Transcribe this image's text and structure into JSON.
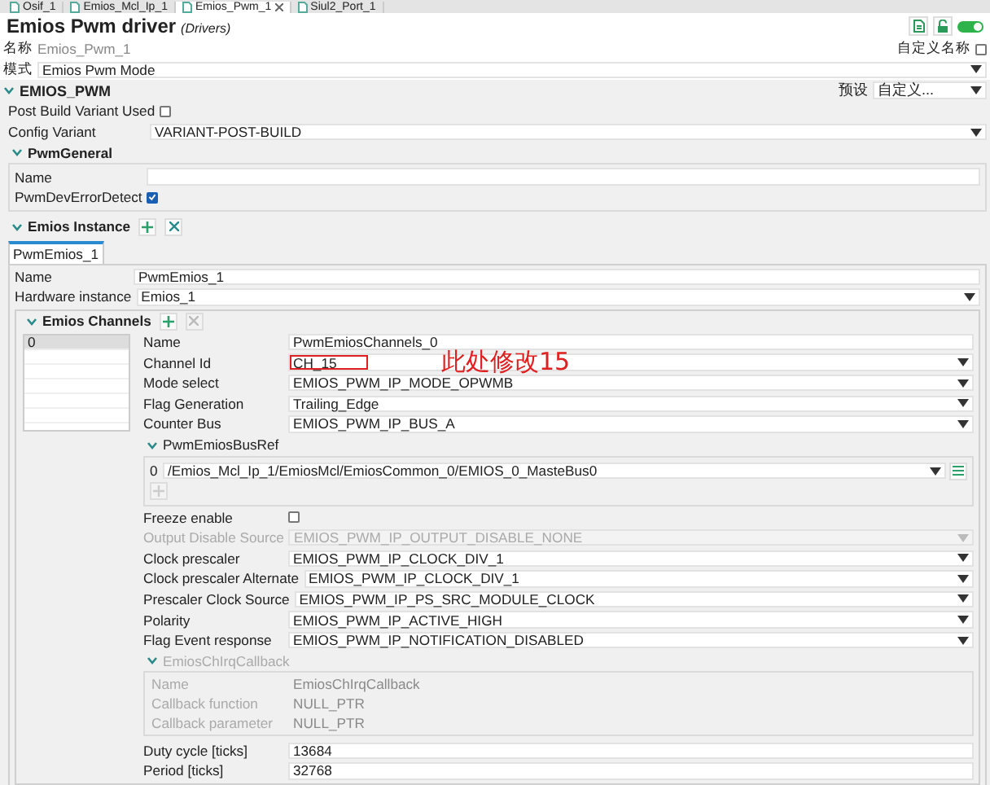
{
  "editor_tabs": [
    {
      "label": "Osif_1",
      "selected": false,
      "closable": false
    },
    {
      "label": "Emios_Mcl_Ip_1",
      "selected": false,
      "closable": false
    },
    {
      "label": "Emios_Pwm_1",
      "selected": true,
      "closable": true
    },
    {
      "label": "Siul2_Port_1",
      "selected": false,
      "closable": false
    }
  ],
  "header": {
    "title": "Emios Pwm driver",
    "subtitle": "(Drivers)",
    "toggle_on": true,
    "name_label": "名称",
    "name_value": "Emios_Pwm_1",
    "custom_name_label": "自定义名称",
    "custom_name_checked": false,
    "mode_label": "模式",
    "mode_value": "Emios Pwm Mode"
  },
  "section": {
    "title": "EMIOS_PWM",
    "expanded": true,
    "preset_label": "预设",
    "preset_value": "自定义...",
    "fields": [
      {
        "kind": "checkbox",
        "label": "Post Build Variant Used",
        "checked": false
      },
      {
        "kind": "dropdown",
        "label": "Config Variant",
        "value": "VARIANT-POST-BUILD"
      }
    ]
  },
  "pwm_general": {
    "title": "PwmGeneral",
    "expanded": true,
    "fields": [
      {
        "kind": "text",
        "label": "Name"
      },
      {
        "kind": "checkbox",
        "label": "PwmDevErrorDetect",
        "checked": true
      }
    ]
  },
  "emios_instance": {
    "title": "Emios Instance",
    "expanded": true,
    "tabs": [
      {
        "label": "PwmEmios_1",
        "selected": true
      }
    ],
    "fields": [
      {
        "kind": "text",
        "label": "Name",
        "value": "PwmEmios_1"
      },
      {
        "kind": "dropdown",
        "label": "Hardware instance",
        "value": "Emios_1"
      }
    ],
    "channels": {
      "title": "Emios Channels",
      "expanded": true,
      "list": [
        {
          "label": "0",
          "selected": true
        }
      ],
      "fields": [
        {
          "kind": "text",
          "label": "Name",
          "value": "PwmEmiosChannels_0",
          "disabled": false
        },
        {
          "kind": "dropdown",
          "label": "Channel Id",
          "value": "CH_15",
          "disabled": false,
          "annotation": "此处修改15"
        },
        {
          "kind": "dropdown",
          "label": "Mode select",
          "value": "EMIOS_PWM_IP_MODE_OPWMB",
          "disabled": false
        },
        {
          "kind": "dropdown",
          "label": "Flag Generation",
          "value": "Trailing_Edge",
          "disabled": false
        },
        {
          "kind": "dropdown",
          "label": "Counter Bus",
          "value": "EMIOS_PWM_IP_BUS_A",
          "disabled": false
        }
      ],
      "bus_ref": {
        "title": "PwmEmiosBusRef",
        "expanded": true,
        "items": [
          {
            "index": "0",
            "value": "/Emios_Mcl_Ip_1/EmiosMcl/EmiosCommon_0/EMIOS_0_MasteBus0"
          }
        ]
      },
      "fields_after": [
        {
          "kind": "checkbox",
          "label": "Freeze enable",
          "checked": false,
          "disabled": false
        },
        {
          "kind": "dropdown",
          "label": "Output Disable Source",
          "value": "EMIOS_PWM_IP_OUTPUT_DISABLE_NONE",
          "disabled": true
        },
        {
          "kind": "dropdown",
          "label": "Clock prescaler",
          "value": "EMIOS_PWM_IP_CLOCK_DIV_1",
          "disabled": false
        },
        {
          "kind": "dropdown",
          "label": "Clock prescaler Alternate",
          "value": "EMIOS_PWM_IP_CLOCK_DIV_1",
          "disabled": false
        },
        {
          "kind": "dropdown",
          "label": "Prescaler Clock Source",
          "value": "EMIOS_PWM_IP_PS_SRC_MODULE_CLOCK",
          "disabled": false
        },
        {
          "kind": "dropdown",
          "label": "Polarity",
          "value": "EMIOS_PWM_IP_ACTIVE_HIGH",
          "disabled": false
        },
        {
          "kind": "dropdown",
          "label": "Flag Event response",
          "value": "EMIOS_PWM_IP_NOTIFICATION_DISABLED",
          "disabled": false
        }
      ],
      "callback": {
        "title": "EmiosChIrqCallback",
        "expanded": true,
        "disabled": true,
        "fields": [
          {
            "label": "Name",
            "value": "EmiosChIrqCallback"
          },
          {
            "label": "Callback function",
            "value": "NULL_PTR"
          },
          {
            "label": "Callback parameter",
            "value": "NULL_PTR"
          }
        ]
      },
      "fields_end": [
        {
          "kind": "text",
          "label": "Duty cycle [ticks]",
          "value": "13684",
          "disabled": false
        },
        {
          "kind": "text",
          "label": "Period [ticks]",
          "value": "32768",
          "disabled": false
        }
      ]
    }
  }
}
